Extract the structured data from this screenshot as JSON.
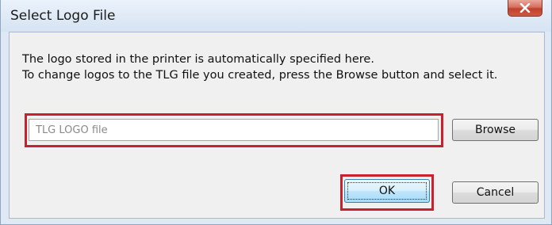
{
  "dialog": {
    "title": "Select Logo File",
    "message_line1": "The logo stored in the printer is automatically specified here.",
    "message_line2": "To change logos to the TLG file you created, press the Browse button and select it.",
    "file_path_value": "TLG LOGO file",
    "browse_label": "Browse",
    "ok_label": "OK",
    "cancel_label": "Cancel"
  },
  "icons": {
    "close": "close-icon"
  },
  "colors": {
    "highlight": "#c8202c",
    "close_button": "#c2402c",
    "frame": "#dfe9f5"
  }
}
